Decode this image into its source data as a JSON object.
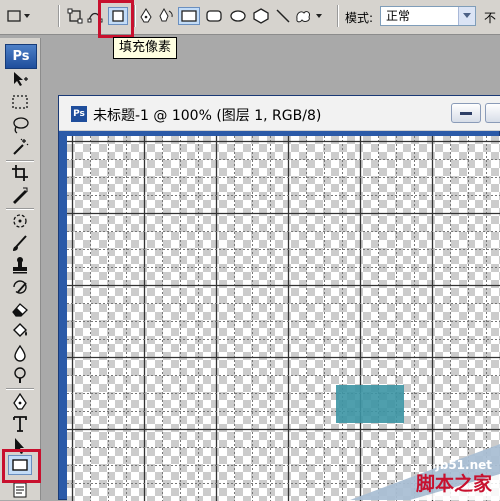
{
  "options_bar": {
    "tooltip": "填充像素",
    "mode_label": "模式:",
    "mode_value": "正常",
    "opacity_stub": "不"
  },
  "toolbox": {
    "logo": "Ps"
  },
  "document": {
    "icon_text": "Ps",
    "title": "未标题-1 @ 100% (图层 1, RGB/8)"
  },
  "watermark": {
    "site": "jb51.net",
    "name": "脚本之家"
  },
  "colors": {
    "highlight_red": "#c8102e",
    "fill_rect": "#3c95a4",
    "doc_frame": "#2b5aa8"
  }
}
